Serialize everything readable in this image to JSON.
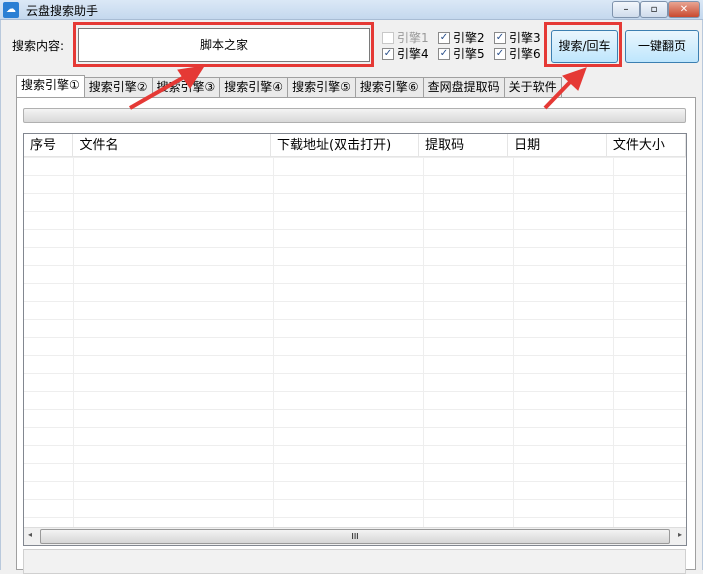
{
  "window": {
    "title": "云盘搜索助手",
    "minimize": "–",
    "maximize": "▫",
    "close": "✕"
  },
  "search": {
    "label": "搜索内容:",
    "value": "脚本之家"
  },
  "engines": [
    {
      "label": "引擎1",
      "checked": false
    },
    {
      "label": "引擎2",
      "checked": true
    },
    {
      "label": "引擎3",
      "checked": true
    },
    {
      "label": "引擎4",
      "checked": true
    },
    {
      "label": "引擎5",
      "checked": true
    },
    {
      "label": "引擎6",
      "checked": true
    }
  ],
  "buttons": {
    "search": "搜索/回车",
    "page": "一键翻页"
  },
  "tabs": [
    "搜索引擎①",
    "搜索引擎②",
    "搜索引擎③",
    "搜索引擎④",
    "搜索引擎⑤",
    "搜索引擎⑥",
    "查网盘提取码",
    "关于软件"
  ],
  "progress": 0,
  "table": {
    "columns": [
      "序号",
      "文件名",
      "下载地址(双击打开)",
      "提取码",
      "日期",
      "文件大小"
    ],
    "rows": []
  },
  "scroll": {
    "left": "◂",
    "right": "▸",
    "grip": "III"
  },
  "accent": "#e53935"
}
